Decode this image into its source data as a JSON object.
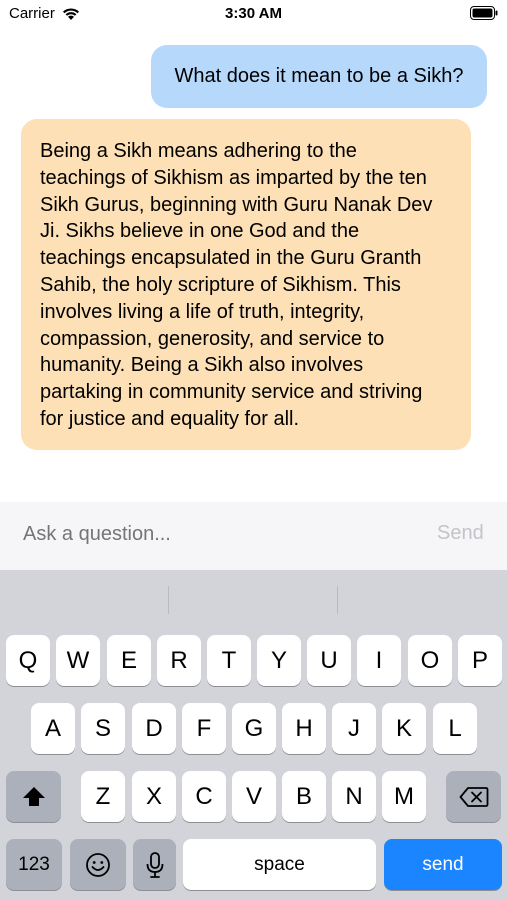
{
  "status": {
    "carrier": "Carrier",
    "time": "3:30 AM"
  },
  "chat": {
    "user_message": "What does it mean to be a Sikh?",
    "bot_lines": [
      "Being a Sikh means adhering to the",
      "teachings of Sikhism as imparted by the ten",
      "Sikh Gurus, beginning with Guru Nanak Dev",
      "Ji. Sikhs believe in one God and the",
      "teachings encapsulated in the Guru Granth",
      "Sahib, the holy scripture of Sikhism. This",
      "involves living a life of truth, integrity,",
      "compassion, generosity, and service to",
      "humanity. Being a Sikh also involves",
      "partaking in community service and striving",
      "for justice and equality for all."
    ]
  },
  "input": {
    "placeholder": "Ask a question...",
    "send_label": "Send"
  },
  "keyboard": {
    "row1": [
      "Q",
      "W",
      "E",
      "R",
      "T",
      "Y",
      "U",
      "I",
      "O",
      "P"
    ],
    "row2": [
      "A",
      "S",
      "D",
      "F",
      "G",
      "H",
      "J",
      "K",
      "L"
    ],
    "row3": [
      "Z",
      "X",
      "C",
      "V",
      "B",
      "N",
      "M"
    ],
    "numbers_label": "123",
    "space_label": "space",
    "send_label": "send"
  },
  "colors": {
    "user_bubble": "#b6d8fb",
    "bot_bubble": "#fde0b6",
    "send_key": "#1b84ff"
  }
}
